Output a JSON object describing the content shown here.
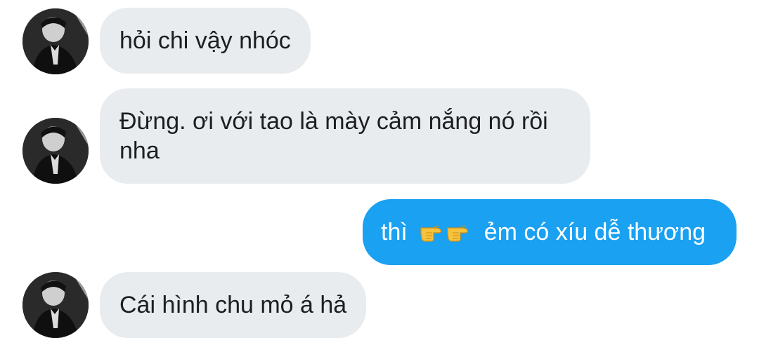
{
  "messages": [
    {
      "sender": "other",
      "text": "hỏi chi vậy nhóc"
    },
    {
      "sender": "other",
      "text": "Đừng. ơi với tao là mày cảm nắng nó rồi nha"
    },
    {
      "sender": "self",
      "text_before": "thì",
      "emoji": [
        "backhand-index-pointing-right-icon",
        "backhand-index-pointing-right-icon"
      ],
      "text_after": "ẻm có xíu dễ thương"
    },
    {
      "sender": "other",
      "text": "Cái hình chu mỏ á hả"
    }
  ],
  "colors": {
    "incoming_bubble": "#e9ecef",
    "outgoing_bubble": "#1aa1f1",
    "incoming_text": "#1c1e21",
    "outgoing_text": "#ffffff"
  }
}
